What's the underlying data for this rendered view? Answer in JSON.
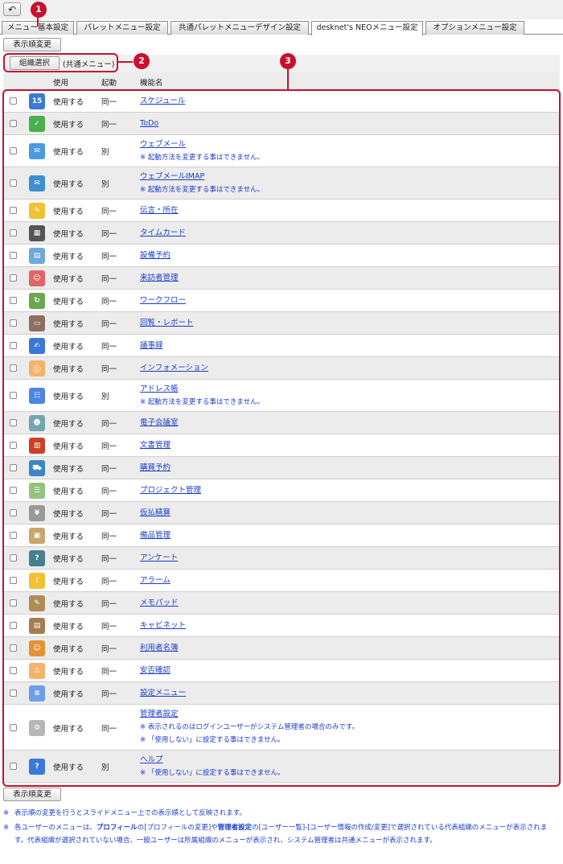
{
  "nav": {
    "back_icon": "back-arrow-icon",
    "back_glyph": "↶"
  },
  "tabs": [
    {
      "label": "メニュー基本設定"
    },
    {
      "label": "パレットメニュー設定"
    },
    {
      "label": "共通パレットメニューデザイン設定"
    },
    {
      "label": "desknet's NEOメニュー設定",
      "active": true
    },
    {
      "label": "オプションメニュー設定"
    }
  ],
  "buttons": {
    "reorder_top": "表示順変更",
    "reorder_bottom": "表示順変更",
    "org_select": "組織選択"
  },
  "org": {
    "current": "(共通メニュー)"
  },
  "callouts": [
    "1",
    "2",
    "3"
  ],
  "table": {
    "headers": {
      "use": "使用",
      "boot": "起動",
      "name": "機能名"
    },
    "rows": [
      {
        "icon": "calendar-icon",
        "use": "使用する",
        "boot": "同一",
        "name": "スケジュール",
        "notes": []
      },
      {
        "icon": "todo-icon",
        "use": "使用する",
        "boot": "同一",
        "name": "ToDo",
        "notes": []
      },
      {
        "icon": "webmail-icon",
        "use": "使用する",
        "boot": "別",
        "name": "ウェブメール",
        "notes": [
          "※ 起動方法を変更する事はできません。"
        ]
      },
      {
        "icon": "webmail-imap-icon",
        "use": "使用する",
        "boot": "別",
        "name": "ウェブメールIMAP",
        "notes": [
          "※ 起動方法を変更する事はできません。"
        ]
      },
      {
        "icon": "memo-note-icon",
        "use": "使用する",
        "boot": "同一",
        "name": "伝言・所在",
        "notes": []
      },
      {
        "icon": "timecard-icon",
        "use": "使用する",
        "boot": "同一",
        "name": "タイムカード",
        "notes": []
      },
      {
        "icon": "facility-icon",
        "use": "使用する",
        "boot": "同一",
        "name": "設備予約",
        "notes": []
      },
      {
        "icon": "visitor-icon",
        "use": "使用する",
        "boot": "同一",
        "name": "来訪者管理",
        "notes": []
      },
      {
        "icon": "workflow-icon",
        "use": "使用する",
        "boot": "同一",
        "name": "ワークフロー",
        "notes": []
      },
      {
        "icon": "report-icon",
        "use": "使用する",
        "boot": "同一",
        "name": "回覧・レポート",
        "notes": []
      },
      {
        "icon": "minutes-icon",
        "use": "使用する",
        "boot": "同一",
        "name": "議事録",
        "notes": []
      },
      {
        "icon": "information-icon",
        "use": "使用する",
        "boot": "同一",
        "name": "インフォメーション",
        "notes": []
      },
      {
        "icon": "address-book-icon",
        "use": "使用する",
        "boot": "別",
        "name": "アドレス帳",
        "notes": [
          "※ 起動方法を変更する事はできません。"
        ]
      },
      {
        "icon": "conference-icon",
        "use": "使用する",
        "boot": "同一",
        "name": "電子会議室",
        "notes": []
      },
      {
        "icon": "document-icon",
        "use": "使用する",
        "boot": "同一",
        "name": "文書管理",
        "notes": []
      },
      {
        "icon": "cart-icon",
        "use": "使用する",
        "boot": "同一",
        "name": "購買予約",
        "notes": []
      },
      {
        "icon": "project-icon",
        "use": "使用する",
        "boot": "同一",
        "name": "プロジェクト管理",
        "notes": []
      },
      {
        "icon": "expense-icon",
        "use": "使用する",
        "boot": "同一",
        "name": "仮払精算",
        "notes": []
      },
      {
        "icon": "equipment-icon",
        "use": "使用する",
        "boot": "同一",
        "name": "備品管理",
        "notes": []
      },
      {
        "icon": "survey-icon",
        "use": "使用する",
        "boot": "同一",
        "name": "アンケート",
        "notes": []
      },
      {
        "icon": "alarm-icon",
        "use": "使用する",
        "boot": "同一",
        "name": "アラーム",
        "notes": []
      },
      {
        "icon": "notepad-icon",
        "use": "使用する",
        "boot": "同一",
        "name": "メモパッド",
        "notes": []
      },
      {
        "icon": "cabinet-icon",
        "use": "使用する",
        "boot": "同一",
        "name": "キャビネット",
        "notes": []
      },
      {
        "icon": "user-directory-icon",
        "use": "使用する",
        "boot": "同一",
        "name": "利用者名簿",
        "notes": []
      },
      {
        "icon": "safety-icon",
        "use": "使用する",
        "boot": "同一",
        "name": "安否確認",
        "notes": []
      },
      {
        "icon": "settings-menu-icon",
        "use": "使用する",
        "boot": "同一",
        "name": "設定メニュー",
        "notes": []
      },
      {
        "icon": "gear-icon",
        "use": "使用する",
        "boot": "同一",
        "name": "管理者設定",
        "notes": [
          "※ 表示されるのはログインユーザーがシステム管理者の場合のみです。",
          "※ 「使用しない」に設定する事はできません。"
        ]
      },
      {
        "icon": "help-icon",
        "use": "使用する",
        "boot": "別",
        "name": "ヘルプ",
        "notes": [
          "※ 「使用しない」に設定する事はできません。"
        ]
      }
    ]
  },
  "footnotes": [
    {
      "mark": "※",
      "text": "表示順の変更を行うとスライドメニュー上での表示順として反映されます。"
    },
    {
      "mark": "※",
      "parts": [
        "各ユーザーのメニューは、",
        "プロフィール",
        "の[プロフィールの変更]や",
        "管理者設定",
        "の[ユーザー一覧]-[ユーザー情報の作成/変更]で選択されている代表組織のメニューが表示されます。代表組織が選択されていない場合、一般ユーザーは所属組織のメニューが表示され、システム管理者は共通メニューが表示されます。"
      ]
    }
  ]
}
